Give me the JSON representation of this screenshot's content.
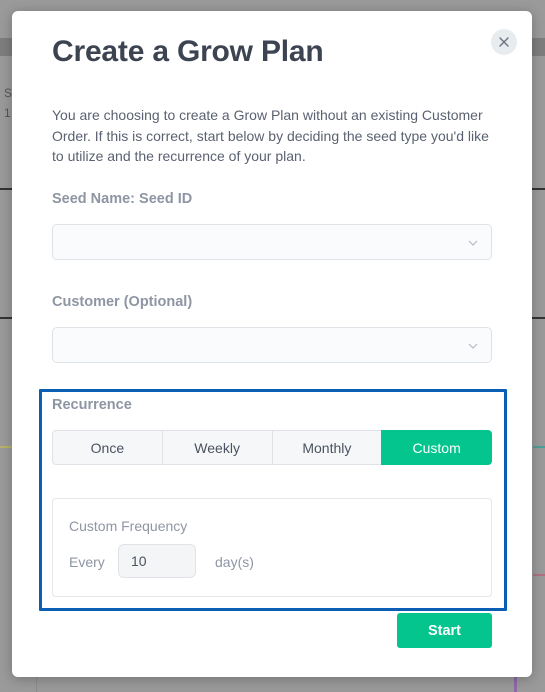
{
  "modal": {
    "title": "Create a Grow Plan",
    "intro": "You are choosing to create a Grow Plan without an existing Customer Order. If this is correct, start below by deciding the seed type you'd like to utilize and the recurrence of your plan.",
    "close_icon": "close-icon"
  },
  "seed": {
    "label": "Seed Name: Seed ID",
    "value": ""
  },
  "customer": {
    "label": "Customer (Optional)",
    "value": ""
  },
  "recurrence": {
    "label": "Recurrence",
    "options": [
      "Once",
      "Weekly",
      "Monthly",
      "Custom"
    ],
    "selected": "Custom"
  },
  "custom_frequency": {
    "title": "Custom Frequency",
    "every_label": "Every",
    "value": "10",
    "unit": "day(s)"
  },
  "actions": {
    "start_label": "Start"
  },
  "colors": {
    "accent": "#04c58e",
    "highlight": "#0a5fb4",
    "title": "#3d4451"
  },
  "background": {
    "partial_text_1": "S",
    "partial_text_2": "1"
  }
}
